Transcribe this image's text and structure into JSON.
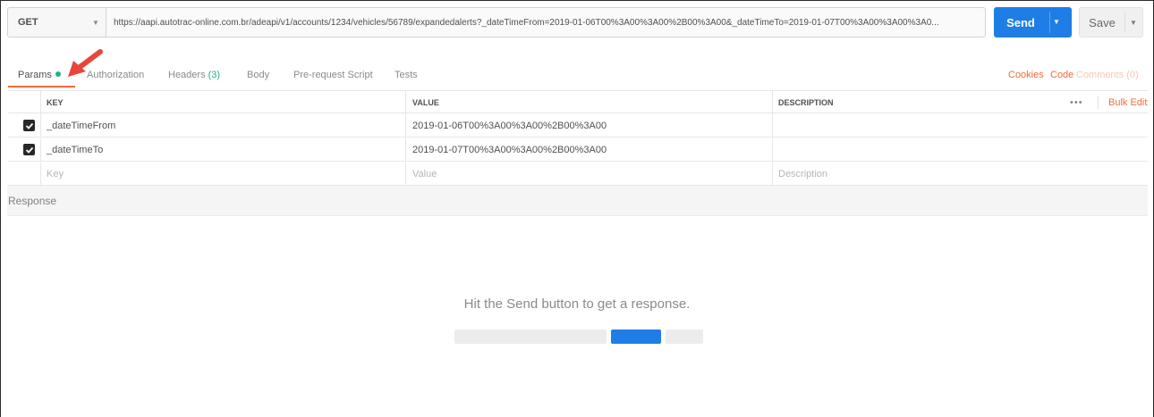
{
  "request": {
    "method": "GET",
    "url": "https://aapi.autotrac-online.com.br/adeapi/v1/accounts/1234/vehicles/56789/expandedalerts?_dateTimeFrom=2019-01-06T00%3A00%3A00%2B00%3A00&_dateTimeTo=2019-01-07T00%3A00%3A00%3A0...",
    "send_label": "Send",
    "save_label": "Save"
  },
  "tabs": [
    {
      "label": "Params"
    },
    {
      "label": "Authorization"
    },
    {
      "label": "Headers",
      "count": "(3)"
    },
    {
      "label": "Body"
    },
    {
      "label": "Pre-request Script"
    },
    {
      "label": "Tests"
    }
  ],
  "links": {
    "cookies": "Cookies",
    "code": "Code",
    "comments": "Comments (0)"
  },
  "params_table": {
    "headers": {
      "key": "KEY",
      "value": "VALUE",
      "description": "DESCRIPTION"
    },
    "bulk_edit": "Bulk Edit",
    "more": "•••",
    "rows": [
      {
        "key": "_dateTimeFrom",
        "value": "2019-01-06T00%3A00%3A00%2B00%3A00",
        "description": ""
      },
      {
        "key": "_dateTimeTo",
        "value": "2019-01-07T00%3A00%3A00%2B00%3A00",
        "description": ""
      }
    ],
    "placeholder": {
      "key": "Key",
      "value": "Value",
      "description": "Description"
    }
  },
  "response": {
    "title": "Response",
    "hint": "Hit the Send button to get a response."
  },
  "colors": {
    "accent": "#f26b3a",
    "primary": "#1f7de6",
    "success": "#26b47f"
  }
}
